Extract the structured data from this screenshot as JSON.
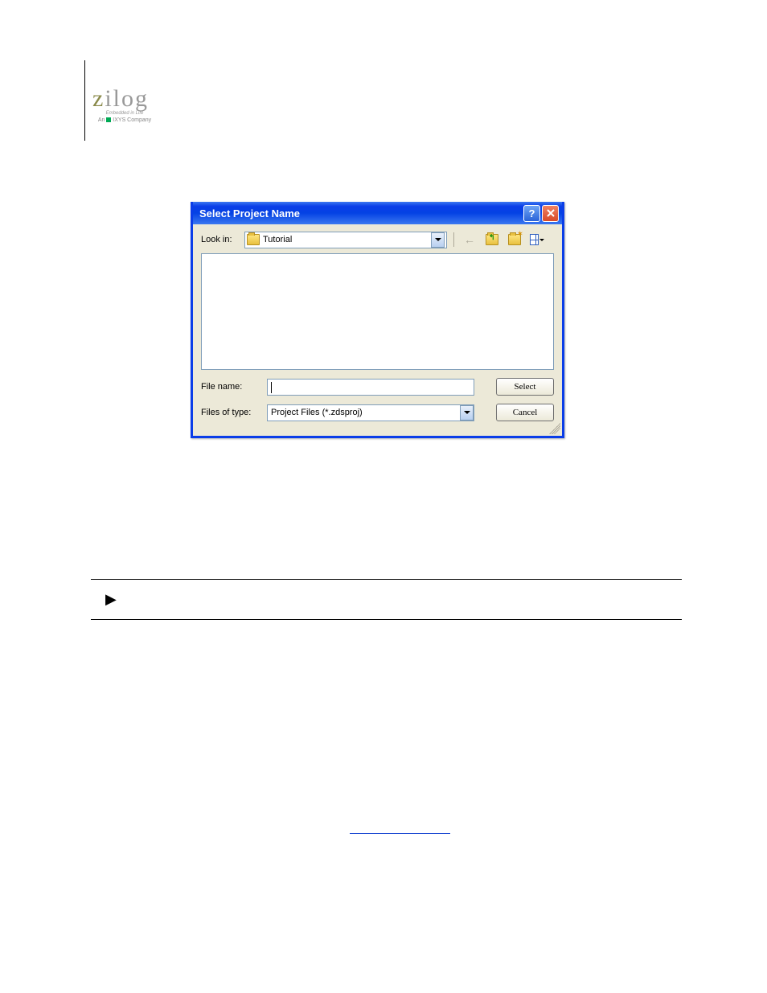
{
  "dialog": {
    "title": "Select Project Name",
    "look_in_label": "Look in:",
    "look_in_value": "Tutorial",
    "file_name_label": "File name:",
    "file_name_value": "",
    "files_type_label": "Files of type:",
    "files_type_value": "Project Files (*.zdsproj)",
    "select_button": "Select",
    "cancel_button": "Cancel"
  }
}
